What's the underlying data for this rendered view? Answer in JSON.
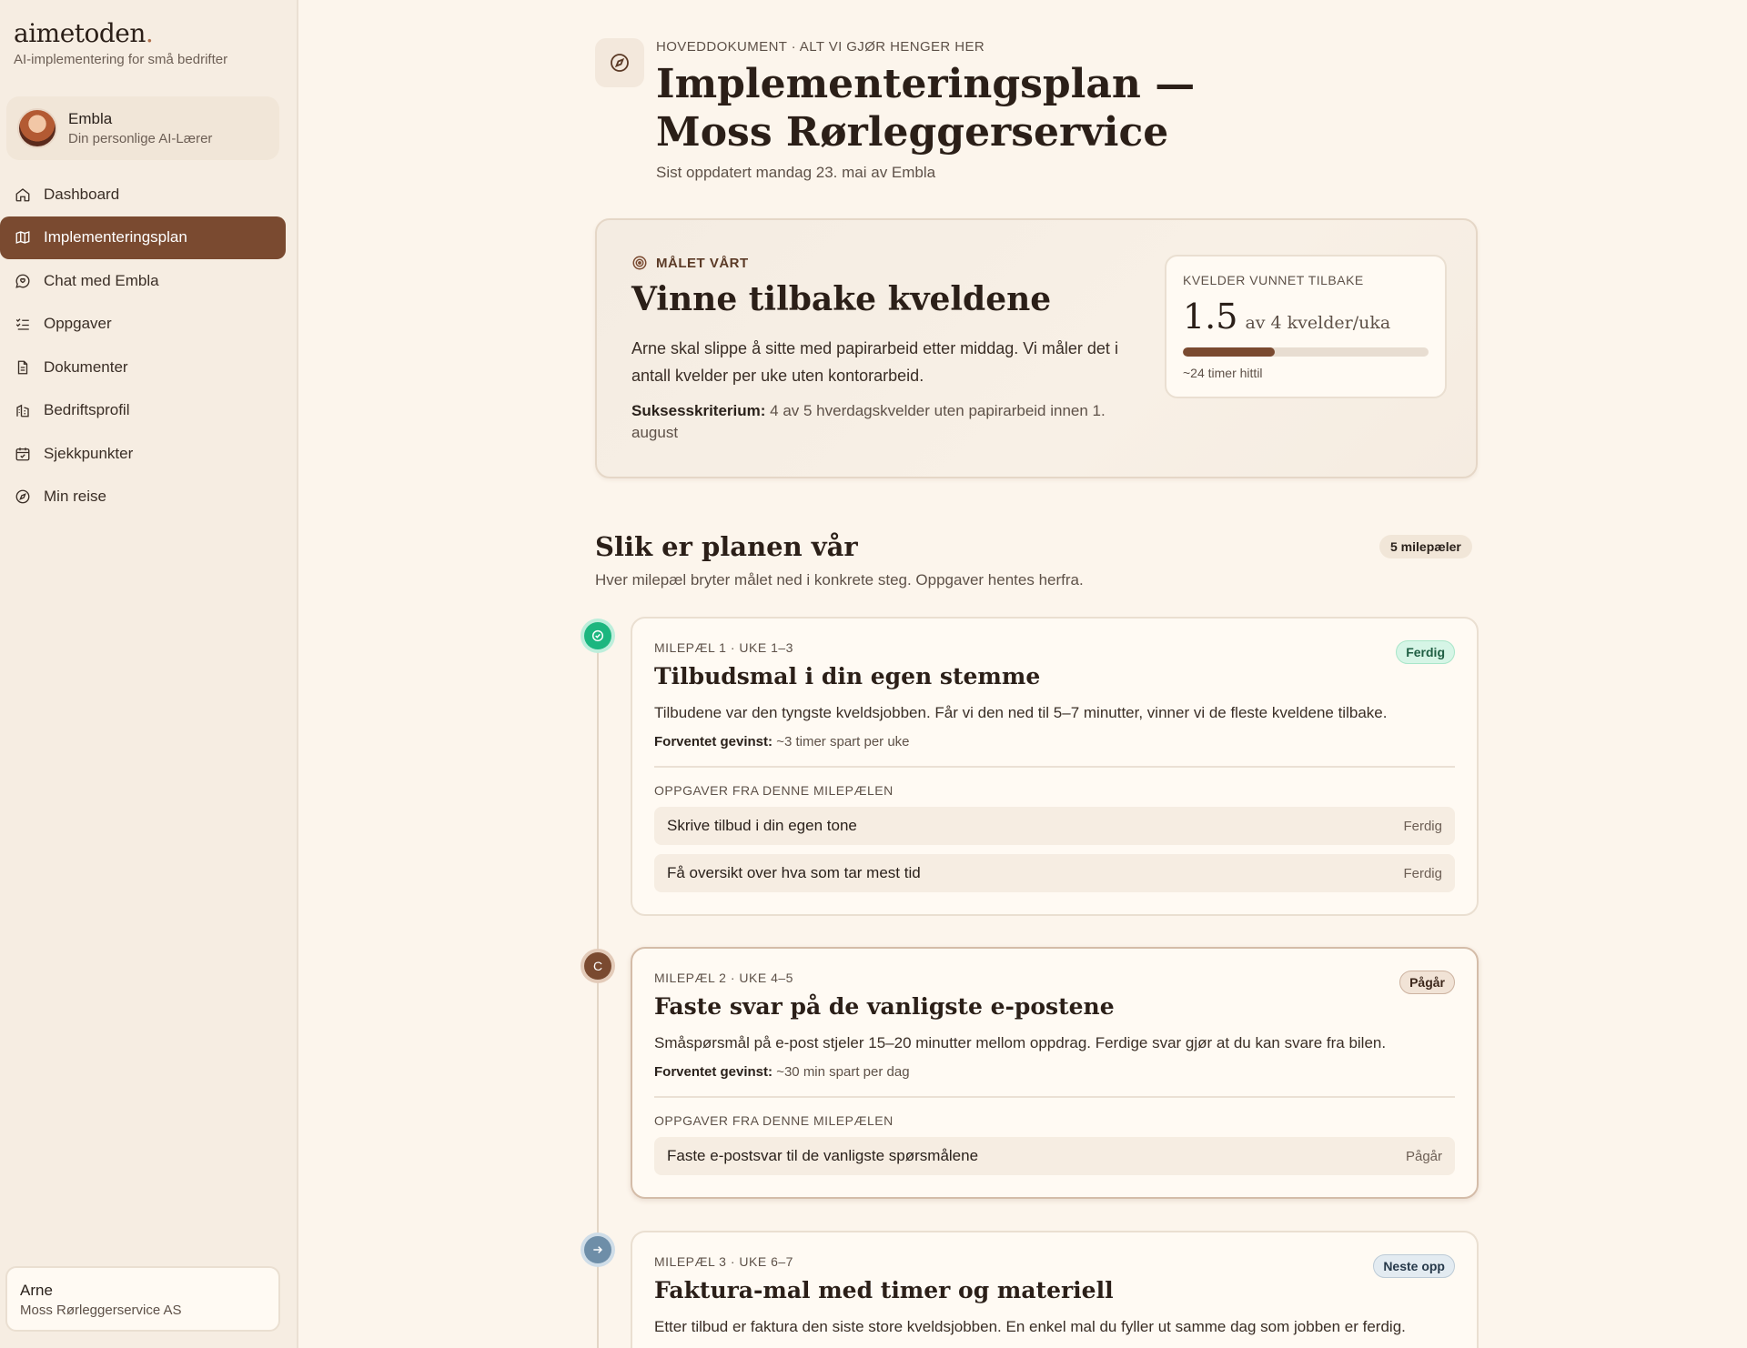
{
  "sidebar": {
    "brand": {
      "name": "aimetoden",
      "dot": ".",
      "tagline": "AI-implementering for små bedrifter"
    },
    "coach": {
      "name": "Embla",
      "role": "Din personlige AI-Lærer"
    },
    "nav": [
      {
        "label": "Dashboard",
        "icon": "home-icon"
      },
      {
        "label": "Implementeringsplan",
        "icon": "map-icon",
        "active": true
      },
      {
        "label": "Chat med Embla",
        "icon": "chat-icon"
      },
      {
        "label": "Oppgaver",
        "icon": "checklist-icon"
      },
      {
        "label": "Dokumenter",
        "icon": "document-icon"
      },
      {
        "label": "Bedriftsprofil",
        "icon": "building-icon"
      },
      {
        "label": "Sjekkpunkter",
        "icon": "calendar-check-icon"
      },
      {
        "label": "Min reise",
        "icon": "compass-icon"
      }
    ],
    "user": {
      "name": "Arne",
      "company": "Moss Rørleggerservice AS"
    }
  },
  "header": {
    "icon": "compass-icon",
    "eyebrow": "HOVEDDOKUMENT · ALT VI GJØR HENGER HER",
    "title": "Implementeringsplan — Moss Rørleggerservice",
    "updated": "Sist oppdatert mandag 23. mai av Embla"
  },
  "goal": {
    "eyebrow": "MÅLET VÅRT",
    "icon": "target-icon",
    "title": "Vinne tilbake kveldene",
    "description": "Arne skal slippe å sitte med papirarbeid etter middag. Vi måler det i antall kvelder per uke uten kontorarbeid.",
    "criterion_label": "Suksesskriterium:",
    "criterion_text": "4 av 5 hverdagskvelder uten papirarbeid innen 1. august",
    "metric": {
      "label": "KVELDER VUNNET TILBAKE",
      "value": "1.5",
      "unit": "av 4 kvelder/uka",
      "progress_fraction": 0.375,
      "footnote": "~24 timer hittil"
    }
  },
  "plan": {
    "title": "Slik er planen vår",
    "count": "5 milepæler",
    "subtitle": "Hver milepæl bryter målet ned i konkrete steg. Oppgaver hentes herfra."
  },
  "milestones": [
    {
      "eyebrow": "MILEPÆL 1 · UKE 1–3",
      "title": "Tilbudsmal i din egen stemme",
      "status": "Ferdig",
      "description": "Tilbudene var den tyngste kveldsjobben. Får vi den ned til 5–7 minutter, vinner vi de fleste kveldene tilbake.",
      "gain_label": "Forventet gevinst:",
      "gain_text": "~3 timer spart per uke",
      "tasks_label": "OPPGAVER FRA DENNE MILEPÆLEN",
      "tasks": [
        {
          "name": "Skrive tilbud i din egen tone",
          "status": "Ferdig"
        },
        {
          "name": "Få oversikt over hva som tar mest tid",
          "status": "Ferdig"
        }
      ]
    },
    {
      "eyebrow": "MILEPÆL 2 · UKE 4–5",
      "title": "Faste svar på de vanligste e-postene",
      "status": "Pågår",
      "dot_letter": "C",
      "description": "Småspørsmål på e-post stjeler 15–20 minutter mellom oppdrag. Ferdige svar gjør at du kan svare fra bilen.",
      "gain_label": "Forventet gevinst:",
      "gain_text": "~30 min spart per dag",
      "tasks_label": "OPPGAVER FRA DENNE MILEPÆLEN",
      "tasks": [
        {
          "name": "Faste e-postsvar til de vanligste spørsmålene",
          "status": "Pågår"
        }
      ]
    },
    {
      "eyebrow": "MILEPÆL 3 · UKE 6–7",
      "title": "Faktura-mal med timer og materiell",
      "status": "Neste opp",
      "description": "Etter tilbud er faktura den siste store kveldsjobben. En enkel mal du fyller ut samme dag som jobben er ferdig."
    }
  ],
  "colors": {
    "accent": "#7a4a30",
    "done": "#1cb67f",
    "next": "#6e8ea8",
    "background": "#fcf5ec"
  }
}
